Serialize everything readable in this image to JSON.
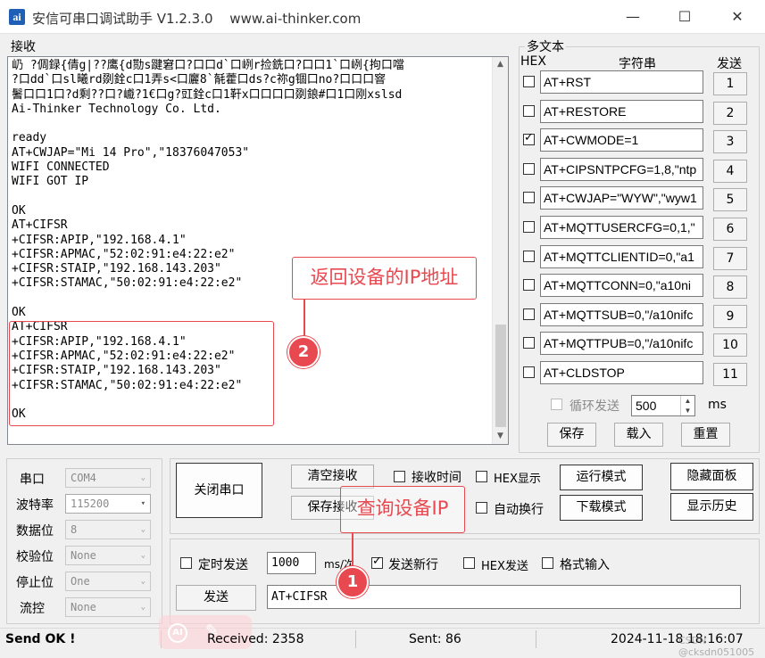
{
  "window": {
    "title": "安信可串口调试助手 V1.2.3.0",
    "url": "www.ai-thinker.com",
    "icon_letter": "ai",
    "minimize": "—",
    "maximize": "☐",
    "close": "✕"
  },
  "receive": {
    "group_label": "接收",
    "lines": [
      "屷 ?倜録{倩g|??鹰{d勚s踺窘口?口口d`口峢r捡銑口?口口1`口峢{拘口噹",
      "?口dd`口sl曦rd剟銓c口1弄s<口廲8`毻藿口ds?c祢g锢口no?口口口窨",
      "鬐口口1口?d剩??口?巇?1€口g?豇銓c口1靬x口口口口剟鋃#口1口刚xslsd",
      "Ai-Thinker Technology Co. Ltd.",
      "",
      "ready",
      "AT+CWJAP=\"Mi 14 Pro\",\"18376047053\"",
      "WIFI CONNECTED",
      "WIFI GOT IP",
      "",
      "OK",
      "AT+CIFSR",
      "+CIFSR:APIP,\"192.168.4.1\"",
      "+CIFSR:APMAC,\"52:02:91:e4:22:e2\"",
      "+CIFSR:STAIP,\"192.168.143.203\"",
      "+CIFSR:STAMAC,\"50:02:91:e4:22:e2\"",
      "",
      "OK",
      "AT+CIFSR",
      "+CIFSR:APIP,\"192.168.4.1\"",
      "+CIFSR:APMAC,\"52:02:91:e4:22:e2\"",
      "+CIFSR:STAIP,\"192.168.143.203\"",
      "+CIFSR:STAMAC,\"50:02:91:e4:22:e2\"",
      "",
      "OK"
    ]
  },
  "annotations": {
    "label_return_ip": "返回设备的IP地址",
    "label_query_ip": "查询设备IP",
    "badge_1": "1",
    "badge_2": "2",
    "color": "#e8484f"
  },
  "multi_text": {
    "group_label": "多文本",
    "col_hex": "HEX",
    "col_string": "字符串",
    "col_send": "发送",
    "rows": [
      {
        "checked": false,
        "text": "AT+RST",
        "btn": "1"
      },
      {
        "checked": false,
        "text": "AT+RESTORE",
        "btn": "2"
      },
      {
        "checked": true,
        "text": "AT+CWMODE=1",
        "btn": "3"
      },
      {
        "checked": false,
        "text": "AT+CIPSNTPCFG=1,8,\"ntp",
        "btn": "4"
      },
      {
        "checked": false,
        "text": "AT+CWJAP=\"WYW\",\"wyw1",
        "btn": "5"
      },
      {
        "checked": false,
        "text": "AT+MQTTUSERCFG=0,1,\"",
        "btn": "6"
      },
      {
        "checked": false,
        "text": "AT+MQTTCLIENTID=0,\"a1",
        "btn": "7"
      },
      {
        "checked": false,
        "text": "AT+MQTTCONN=0,\"a10ni",
        "btn": "8"
      },
      {
        "checked": false,
        "text": "AT+MQTTSUB=0,\"/a10nifc",
        "btn": "9"
      },
      {
        "checked": false,
        "text": "AT+MQTTPUB=0,\"/a10nifc",
        "btn": "10"
      },
      {
        "checked": false,
        "text": "AT+CLDSTOP",
        "btn": "11"
      }
    ],
    "loop_label": "循环发送",
    "loop_value": "500",
    "loop_unit": "ms",
    "save": "保存",
    "load": "载入",
    "reset": "重置"
  },
  "port": {
    "port_label": "串口",
    "port_value": "COM4",
    "baud_label": "波特率",
    "baud_value": "115200",
    "data_label": "数据位",
    "data_value": "8",
    "parity_label": "校验位",
    "parity_value": "None",
    "stop_label": "停止位",
    "stop_value": "One",
    "flow_label": "流控",
    "flow_value": "None"
  },
  "controls": {
    "close_port": "关闭串口",
    "clear_recv": "清空接收",
    "save_recv": "保存接收",
    "recv_time": "接收时间",
    "hex_display": "HEX显示",
    "auto_wrap": "自动换行",
    "run_mode": "运行模式",
    "download_mode": "下载模式",
    "hide_panel": "隐藏面板",
    "show_history": "显示历史"
  },
  "send": {
    "timed_send": "定时发送",
    "interval": "1000",
    "interval_unit": "ms/次",
    "send_newline": "发送新行",
    "hex_send": "HEX发送",
    "format_input": "格式输入",
    "send_button": "发送",
    "send_text": "AT+CIFSR"
  },
  "status": {
    "state": "Send OK !",
    "received": "Received: 2358",
    "sent": "Sent: 86",
    "datetime": "2024-11-18 18:16:07",
    "watermark": "CSDN @cksdn051005"
  }
}
